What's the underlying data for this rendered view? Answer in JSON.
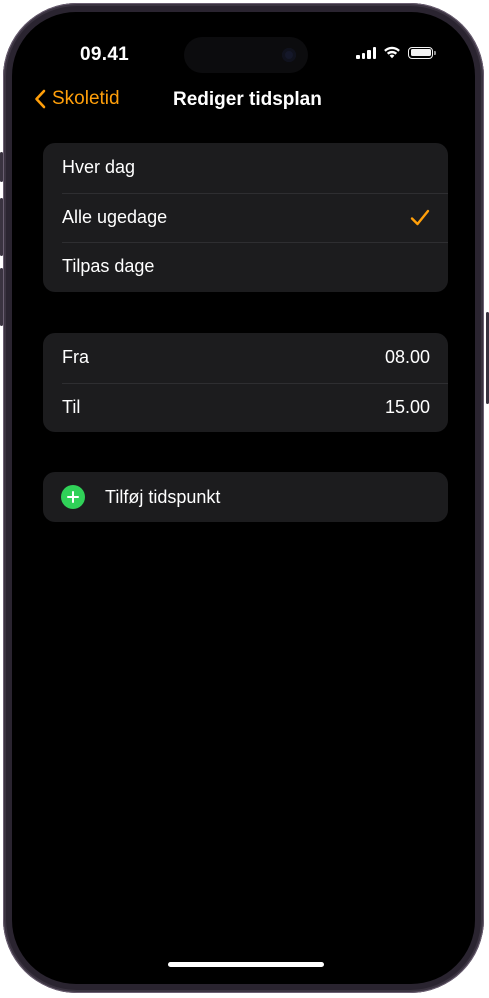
{
  "status_bar": {
    "time": "09.41"
  },
  "nav": {
    "back_label": "Skoletid",
    "title": "Rediger tidsplan"
  },
  "day_options": [
    {
      "label": "Hver dag",
      "selected": false
    },
    {
      "label": "Alle ugedage",
      "selected": true
    },
    {
      "label": "Tilpas dage",
      "selected": false
    }
  ],
  "time_range": {
    "from_label": "Fra",
    "from_value": "08.00",
    "to_label": "Til",
    "to_value": "15.00"
  },
  "add_time": {
    "label": "Tilføj tidspunkt"
  },
  "colors": {
    "accent": "#ff9f0a",
    "add_green": "#30d158",
    "group_bg": "#1c1c1e"
  },
  "icons": {
    "back": "chevron-left-icon",
    "check": "checkmark-icon",
    "add": "plus-circle-icon",
    "signal": "cellular-signal-icon",
    "wifi": "wifi-icon",
    "battery": "battery-icon"
  }
}
